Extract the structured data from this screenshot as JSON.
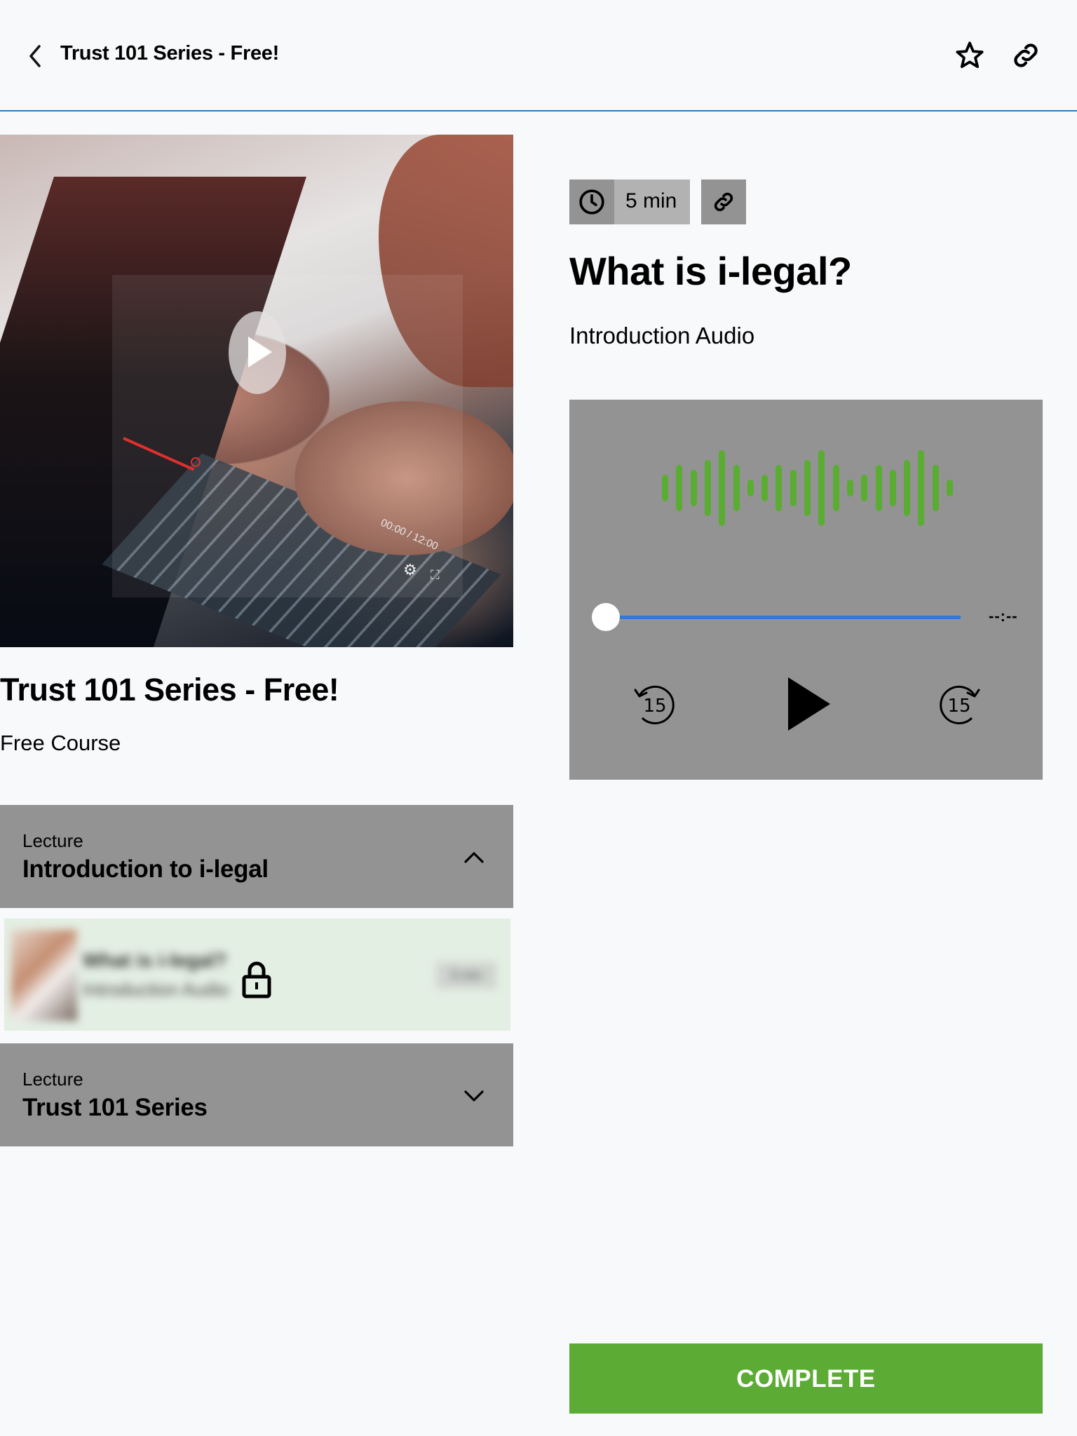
{
  "header": {
    "title": "Trust 101 Series - Free!",
    "back_icon": "chevron-left-icon",
    "actions": [
      {
        "name": "favorite",
        "icon": "star-outline-icon"
      },
      {
        "name": "share-link",
        "icon": "link-icon"
      }
    ],
    "accent_color": "#2f7ab8"
  },
  "course": {
    "title": "Trust 101 Series - Free!",
    "subtitle": "Free Course",
    "hero_overlay_time": "00:00 / 12:00"
  },
  "sections": [
    {
      "kicker": "Lecture",
      "title": "Introduction to i-legal",
      "expanded": true,
      "icon": "chevron-up-icon",
      "lessons": [
        {
          "title": "What is i-legal?",
          "subtitle": "Introduction Audio",
          "duration": "5 min",
          "locked": true,
          "icon": "lock-icon"
        }
      ]
    },
    {
      "kicker": "Lecture",
      "title": "Trust 101 Series",
      "expanded": false,
      "icon": "chevron-down-icon"
    }
  ],
  "lesson": {
    "duration": "5 min",
    "duration_icon": "clock-icon",
    "link_icon": "link-icon",
    "title": "What is i-legal?",
    "subtitle": "Introduction Audio"
  },
  "player": {
    "progress": 0,
    "time_display": "--:--",
    "skip_back_seconds": "15",
    "skip_forward_seconds": "15",
    "waveform_color": "#5aac33",
    "track_color": "#2f7bd0",
    "state": "paused"
  },
  "complete_button": {
    "label": "COMPLETE",
    "color": "#5cab34"
  }
}
